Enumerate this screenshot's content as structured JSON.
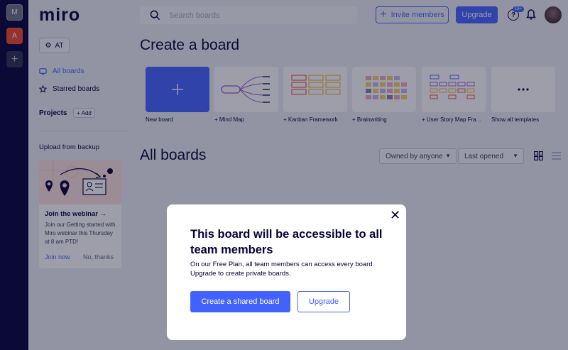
{
  "header": {
    "logo": "miro",
    "search_placeholder": "Search boards",
    "invite_label": "Invite members",
    "upgrade_label": "Upgrade",
    "help_badge": "16+"
  },
  "rail": {
    "items": [
      {
        "initial": "M"
      },
      {
        "initial": "A"
      }
    ],
    "add_label": "+"
  },
  "sidebar": {
    "team_label": "AT",
    "nav": [
      {
        "label": "All boards",
        "active": true
      },
      {
        "label": "Starred boards",
        "active": false
      }
    ],
    "projects_title": "Projects",
    "add_project_label": "+ Add",
    "backup_label": "Upload from backup",
    "webinar": {
      "title": "Join the webinar →",
      "body": "Join our Getting started with Miro webinar this Thursday at 8 am PTD!",
      "join_label": "Join now",
      "dismiss_label": "No, thanks"
    }
  },
  "main": {
    "create_title": "Create a board",
    "templates": [
      {
        "label": "New board"
      },
      {
        "label": "+ Mind Map"
      },
      {
        "label": "+ Kanban Framework"
      },
      {
        "label": "+ Brainwriting"
      },
      {
        "label": "+ User Story Map Fra..."
      },
      {
        "label": "Show all templates"
      }
    ],
    "all_boards_title": "All boards",
    "owner_filter": "Owned by anyone",
    "sort_filter": "Last opened"
  },
  "modal": {
    "title": "This board will be accessible to all team members",
    "text": "On our Free Plan, all team members can access every board. Upgrade to create private boards.",
    "primary_label": "Create a shared board",
    "secondary_label": "Upgrade",
    "close_symbol": "✕"
  },
  "colors": {
    "accent": "#4262ff",
    "dark": "#050038",
    "rail_avatar_a": "#f24726",
    "webinar_art_bg": "#fde0dc"
  }
}
